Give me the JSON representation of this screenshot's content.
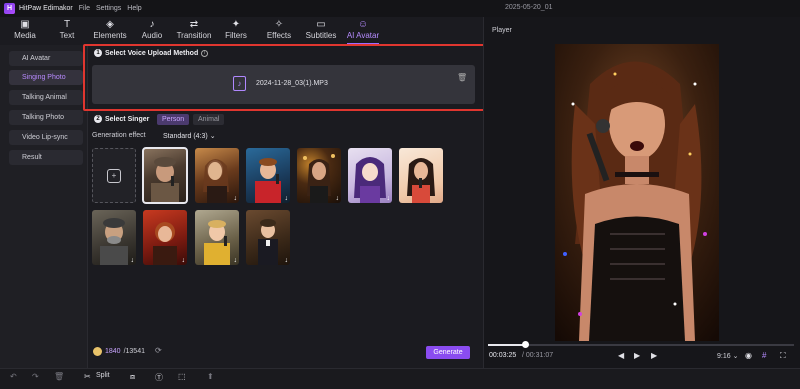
{
  "app": {
    "name": "HitPaw Edimakor",
    "menus": [
      "File",
      "Settings",
      "Help"
    ],
    "window_title": "2025-05-20_01"
  },
  "toolbar": [
    {
      "label": "Media",
      "icon": "media-icon",
      "glyph": "▣"
    },
    {
      "label": "Text",
      "icon": "text-icon",
      "glyph": "T"
    },
    {
      "label": "Elements",
      "icon": "elements-icon",
      "glyph": "◈"
    },
    {
      "label": "Audio",
      "icon": "audio-icon",
      "glyph": "♪"
    },
    {
      "label": "Transition",
      "icon": "transition-icon",
      "glyph": "⇄"
    },
    {
      "label": "Filters",
      "icon": "filters-icon",
      "glyph": "✦"
    },
    {
      "label": "Effects",
      "icon": "effects-icon",
      "glyph": "✧"
    },
    {
      "label": "Subtitles",
      "icon": "subtitles-icon",
      "glyph": "▭"
    },
    {
      "label": "AI Avatar",
      "icon": "ai-avatar-icon",
      "glyph": "☺",
      "active": true
    }
  ],
  "sidebar": {
    "items": [
      {
        "label": "AI Avatar"
      },
      {
        "label": "Singing Photo",
        "active": true
      },
      {
        "label": "Talking Animal"
      },
      {
        "label": "Talking Photo"
      },
      {
        "label": "Video Lip-sync"
      },
      {
        "label": "Result"
      }
    ]
  },
  "upload": {
    "step": "1",
    "title": "Select Voice Upload Method",
    "file_name": "2024-11-28_03(1).MP3"
  },
  "singer": {
    "step": "2",
    "title": "Select Singer",
    "tabs": [
      "Person",
      "Animal"
    ],
    "generation_label": "Generation effect",
    "generation_value": "Standard (4:3)"
  },
  "credits": {
    "used": "1840",
    "total": "/13541"
  },
  "generate_label": "Generate",
  "player": {
    "title": "Player",
    "current_time": "00:03:25",
    "total_time": "/ 00:31:07",
    "ratio": "9:16",
    "progress": 0.12
  },
  "bottom": {
    "split_label": "Split"
  },
  "colors": {
    "accent": "#8a4cf0",
    "highlight_border": "#e0362f"
  }
}
